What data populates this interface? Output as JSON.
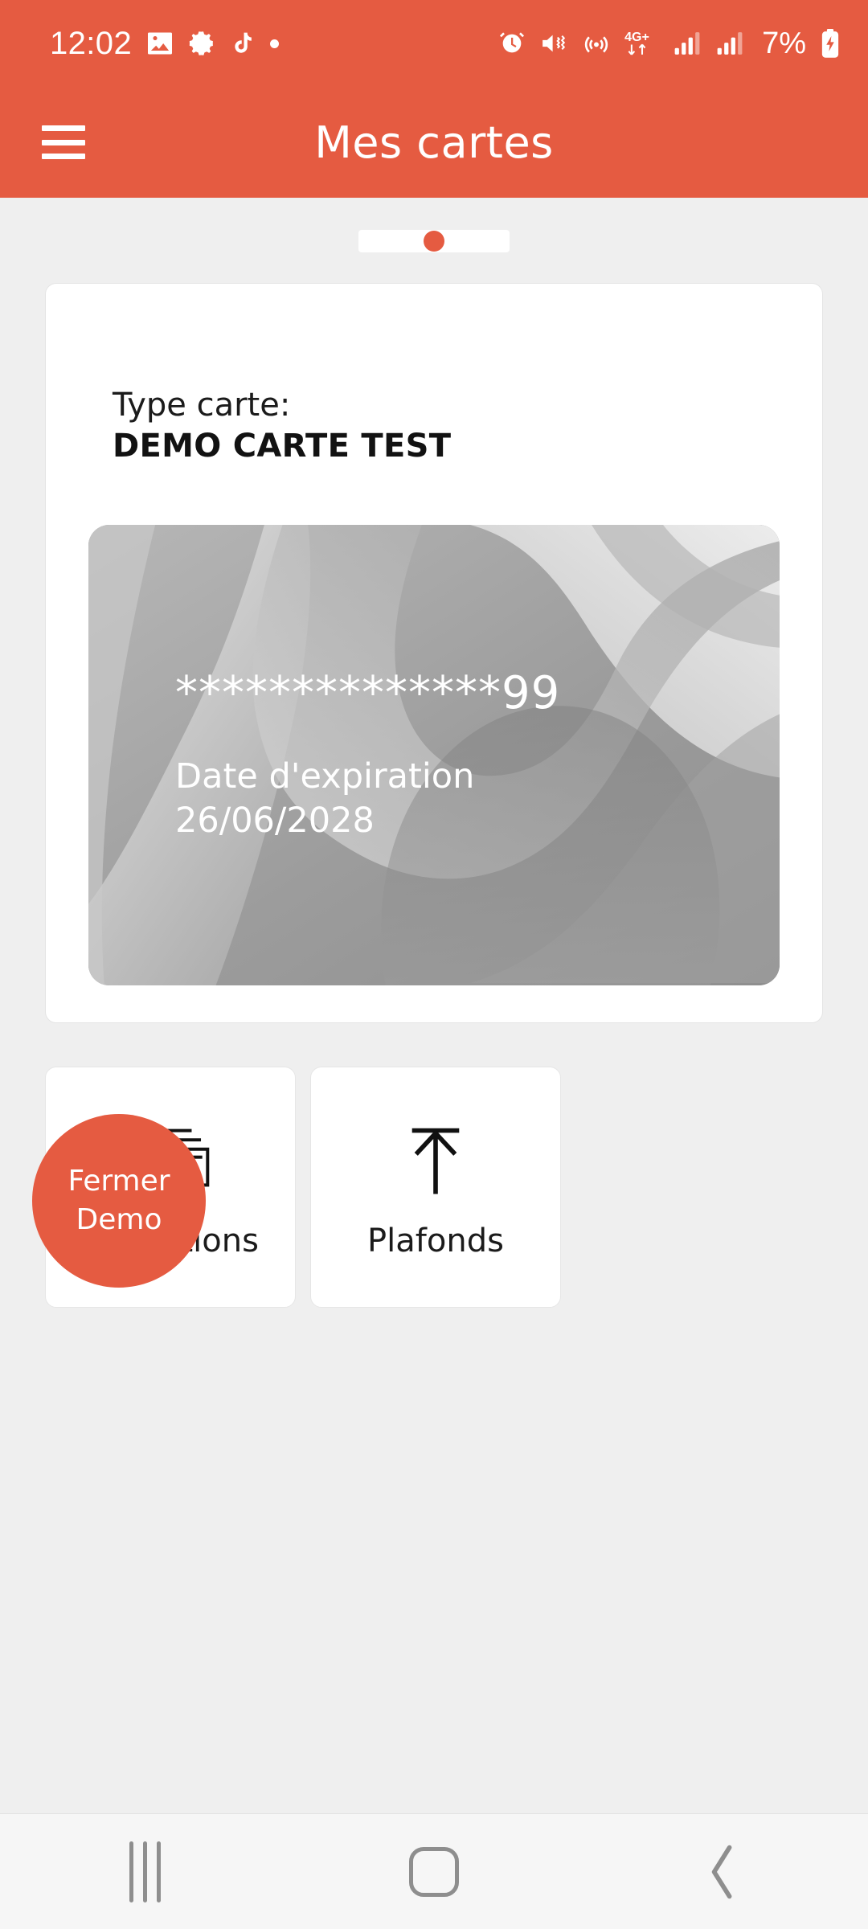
{
  "status_bar": {
    "time": "12:02",
    "left_icons": [
      "gallery-icon",
      "settings-gear-icon",
      "tiktok-note-icon",
      "dot-icon"
    ],
    "right_icons": [
      "alarm-clock-icon",
      "mute-vibrate-icon",
      "hotspot-icon",
      "network-4gplus-icon",
      "signal-bars-icon",
      "signal-bars-icon"
    ],
    "battery_percent": "7%",
    "battery_state": "charging"
  },
  "app_bar": {
    "menu_icon": "hamburger-menu-icon",
    "title": "Mes cartes"
  },
  "pager": {
    "total": 1,
    "active_index": 0
  },
  "card_panel": {
    "type_label": "Type carte:",
    "type_value": "DEMO CARTE TEST",
    "card_number": "**************99",
    "expiry_label": "Date d'expiration",
    "expiry_value": "26/06/2028"
  },
  "actions": [
    {
      "label": "Opérations",
      "icon": "banknotes-stack-icon"
    },
    {
      "label": "Plafonds",
      "icon": "arrow-up-ceiling-icon"
    }
  ],
  "fab": {
    "label": "Fermer\nDemo"
  },
  "nav_bar": {
    "recents": "recent-apps-icon",
    "home": "home-icon",
    "back": "back-chevron-icon"
  },
  "colors": {
    "accent": "#e55b41",
    "background": "#efefef",
    "surface": "#ffffff",
    "nav_bar": "#f6f6f6"
  }
}
